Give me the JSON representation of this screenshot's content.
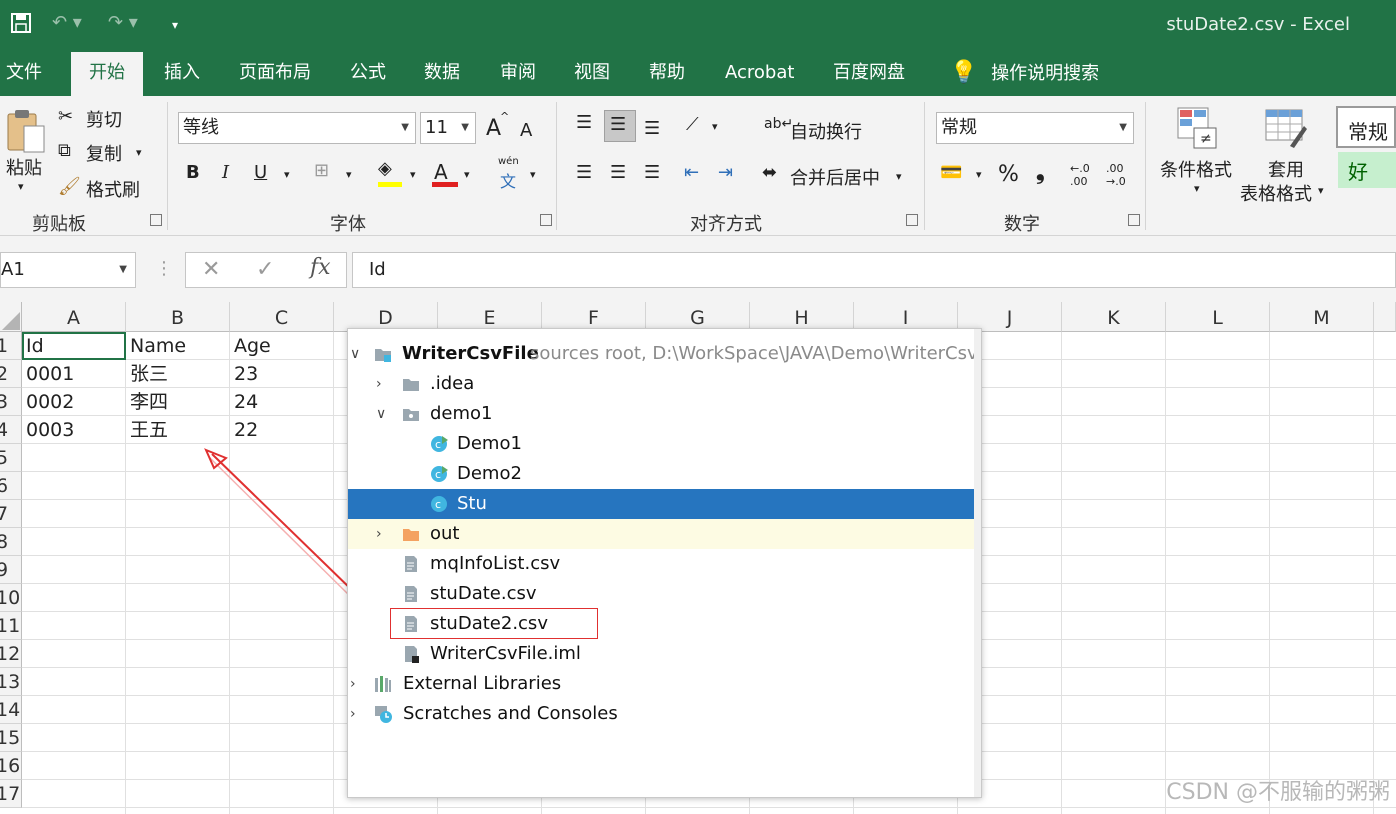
{
  "window": {
    "title": "stuDate2.csv  -  Excel"
  },
  "tabs": [
    "文件",
    "开始",
    "插入",
    "页面布局",
    "公式",
    "数据",
    "审阅",
    "视图",
    "帮助",
    "Acrobat",
    "百度网盘",
    "操作说明搜索"
  ],
  "clipboard": {
    "paste": "粘贴",
    "cut": "剪切",
    "copy": "复制",
    "format_painter": "格式刷",
    "group": "剪贴板"
  },
  "font": {
    "name": "等线",
    "size": "11",
    "bold": "B",
    "italic": "I",
    "underline": "U",
    "grow": "A",
    "shrink": "A",
    "wen": "wén",
    "wen_char": "文",
    "group": "字体"
  },
  "alignment": {
    "wrap": "自动换行",
    "merge": "合并后居中",
    "group": "对齐方式"
  },
  "number": {
    "format": "常规",
    "percent": "%",
    "comma": "❟",
    "group": "数字"
  },
  "styles": {
    "conditional": "条件格式",
    "table_1": "套用",
    "table_2": "表格格式",
    "normal": "常规",
    "good": "好"
  },
  "formula_bar": {
    "name_box": "A1",
    "fx": "fx",
    "value": "Id"
  },
  "columns": [
    "A",
    "B",
    "C",
    "D",
    "E",
    "F",
    "G",
    "H",
    "I",
    "J",
    "K",
    "L",
    "M"
  ],
  "rows": [
    "1",
    "2",
    "3",
    "4",
    "5",
    "6",
    "7",
    "8",
    "9",
    "10",
    "11",
    "12",
    "13",
    "14",
    "15",
    "16",
    "17"
  ],
  "cells": [
    [
      "Id",
      "Name",
      "Age"
    ],
    [
      "0001",
      "张三",
      "23"
    ],
    [
      "0002",
      "李四",
      "24"
    ],
    [
      "0003",
      "王五",
      "22"
    ]
  ],
  "tree": {
    "root": "WriterCsvFile",
    "root_note": "sources root,  D:\\WorkSpace\\JAVA\\Demo\\WriterCsvFile",
    "idea": ".idea",
    "demo1": "demo1",
    "demo1_cls": "Demo1",
    "demo2_cls": "Demo2",
    "stu_cls": "Stu",
    "out": "out",
    "file1": "mqInfoList.csv",
    "file2": "stuDate.csv",
    "file3": "stuDate2.csv",
    "file4": "WriterCsvFile.iml",
    "ext": "External Libraries",
    "scratch": "Scratches and Consoles"
  },
  "watermark": "CSDN @不服输的粥粥",
  "colors": {
    "excel_green": "#217346",
    "selection_blue": "#2675bf",
    "annotation_red": "#e03030"
  }
}
